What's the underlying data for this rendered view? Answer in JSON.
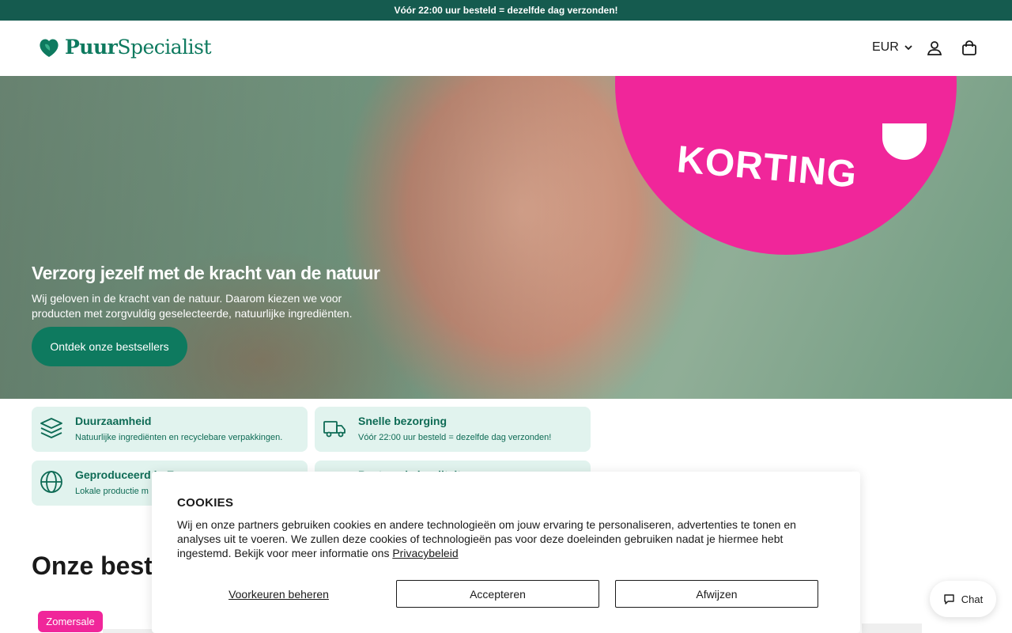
{
  "announcement": {
    "text": "Vóór 22:00 uur besteld = dezelfde dag verzonden!"
  },
  "header": {
    "logo": {
      "part1": "Puur",
      "part2": "Specialist"
    },
    "currency": "EUR",
    "icons": [
      "chevron-down-icon",
      "user-icon",
      "shopping-bag-icon"
    ]
  },
  "hero": {
    "promo_text": "KORTING",
    "title": "Verzorg jezelf met de kracht van de natuur",
    "subtitle": "Wij geloven in de kracht van de natuur. Daarom kiezen we voor producten met zorgvuldig geselecteerde, natuurlijke ingrediënten.",
    "cta": "Ontdek onze bestsellers"
  },
  "usps": [
    {
      "icon": "layers-icon",
      "title": "Duurzaamheid",
      "desc": "Natuurlijke ingrediënten en recyclebare verpakkingen."
    },
    {
      "icon": "truck-icon",
      "title": "Snelle bezorging",
      "desc": "Vóór 22:00 uur besteld = dezelfde dag verzonden!"
    },
    {
      "icon": "globe-icon",
      "title": "Geproduceerd in E",
      "desc": "Lokale productie m"
    },
    {
      "icon": "quality-icon",
      "title": "Bestaande kwaliteit",
      "desc": ""
    }
  ],
  "bestsellers": {
    "title": "Onze best",
    "badge": "Zomersale"
  },
  "cookie": {
    "title": "COOKIES",
    "text": "Wij en onze partners gebruiken cookies en andere technologieën om jouw ervaring te personaliseren, advertenties te tonen en analyses uit te voeren. We zullen deze cookies of technologieën pas voor deze doeleinden gebruiken nadat je hiermee hebt ingestemd. Bekijk voor meer informatie ons",
    "link": "Privacybeleid",
    "preferences": "Voorkeuren beheren",
    "accept": "Accepteren",
    "reject": "Afwijzen"
  },
  "chat": {
    "label": "Chat",
    "icon": "chat-bubble-icon"
  },
  "colors": {
    "brand": "#0e7a5f",
    "announcement_bg": "#155b4f",
    "promo": "#f0269a",
    "usp_bg": "#e1f3ee"
  }
}
